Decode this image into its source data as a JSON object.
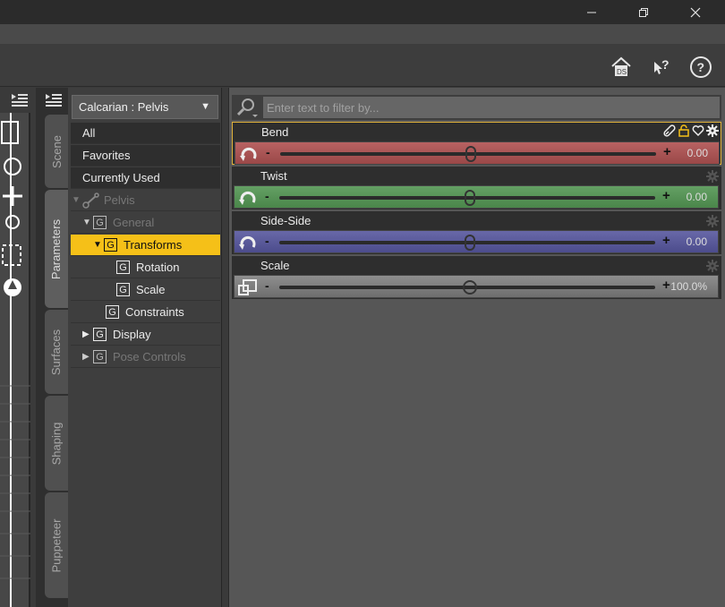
{
  "window": {
    "min_icon": "minimize-icon",
    "max_icon": "restore-icon",
    "close_icon": "close-icon"
  },
  "toolbar": {
    "icons": [
      "daz-home-icon",
      "whats-this-icon",
      "help-icon"
    ]
  },
  "tabs": [
    {
      "label": "Scene",
      "active": false
    },
    {
      "label": "Parameters",
      "active": true
    },
    {
      "label": "Surfaces",
      "active": false
    },
    {
      "label": "Shaping",
      "active": false
    },
    {
      "label": "Puppeteer",
      "active": false
    }
  ],
  "node_selector": "Calcarian : Pelvis",
  "tree": {
    "all": "All",
    "favorites": "Favorites",
    "currently_used": "Currently Used",
    "pelvis": "Pelvis",
    "general": "General",
    "transforms": "Transforms",
    "rotation": "Rotation",
    "scale": "Scale",
    "constraints": "Constraints",
    "display": "Display",
    "pose_controls": "Pose Controls"
  },
  "filter": {
    "placeholder": "Enter text to filter by..."
  },
  "params": [
    {
      "label": "Bend",
      "value": "0.00",
      "minus": "-",
      "plus": "+",
      "color": "#b85a5a",
      "position": 0.5
    },
    {
      "label": "Twist",
      "value": "0.00",
      "minus": "-",
      "plus": "+",
      "color": "#5a9a5a",
      "position": 0.5
    },
    {
      "label": "Side-Side",
      "value": "0.00",
      "minus": "-",
      "plus": "+",
      "color": "#5a5a9a",
      "position": 0.5
    },
    {
      "label": "Scale",
      "value": "100.0%",
      "minus": "-",
      "plus": "+",
      "color": "#8a8a8a",
      "position": 0.5
    }
  ],
  "colors": {
    "accent": "#f5c018",
    "highlight_border": "#e0b23a"
  }
}
